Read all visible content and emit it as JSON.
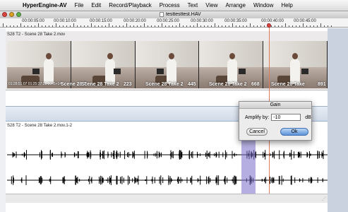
{
  "menubar": {
    "app_name": "HyperEngine-AV",
    "items": [
      "File",
      "Edit",
      "Record/Playback",
      "Process",
      "Text",
      "View",
      "Arrange",
      "Window",
      "Help"
    ]
  },
  "window": {
    "title": "testtesttest.HAV"
  },
  "ruler": {
    "labels": [
      "00:00:05:00",
      "00:00:10:00",
      "00:00:15:00",
      "00:00:20:00",
      "00:00:25:00",
      "00:00:30:00",
      "00:00:35:00",
      "00:00:40:00",
      "00:00:45:00"
    ]
  },
  "video_track": {
    "label": "S28 T2 - Scene 28 Take 2.mov",
    "timecode": "01:28:51:07  01:25:37:21  8045+14*",
    "frame_captions": [
      "Scene 28 T",
      "Scene 28 Take 2",
      "223",
      "Scene 28 Take 2",
      "445",
      "Scene 28 Take 2",
      "668",
      "Scene 28 Take",
      "891"
    ]
  },
  "audio_track": {
    "label": "S28 T2 - Scene 28 Take 2.mov.1-2"
  },
  "gain_dialog": {
    "title": "Gain",
    "amplify_label": "Amplify by:",
    "amplify_value": "-10",
    "unit": "dB",
    "cancel_label": "Cancel",
    "ok_label": "Ok"
  }
}
